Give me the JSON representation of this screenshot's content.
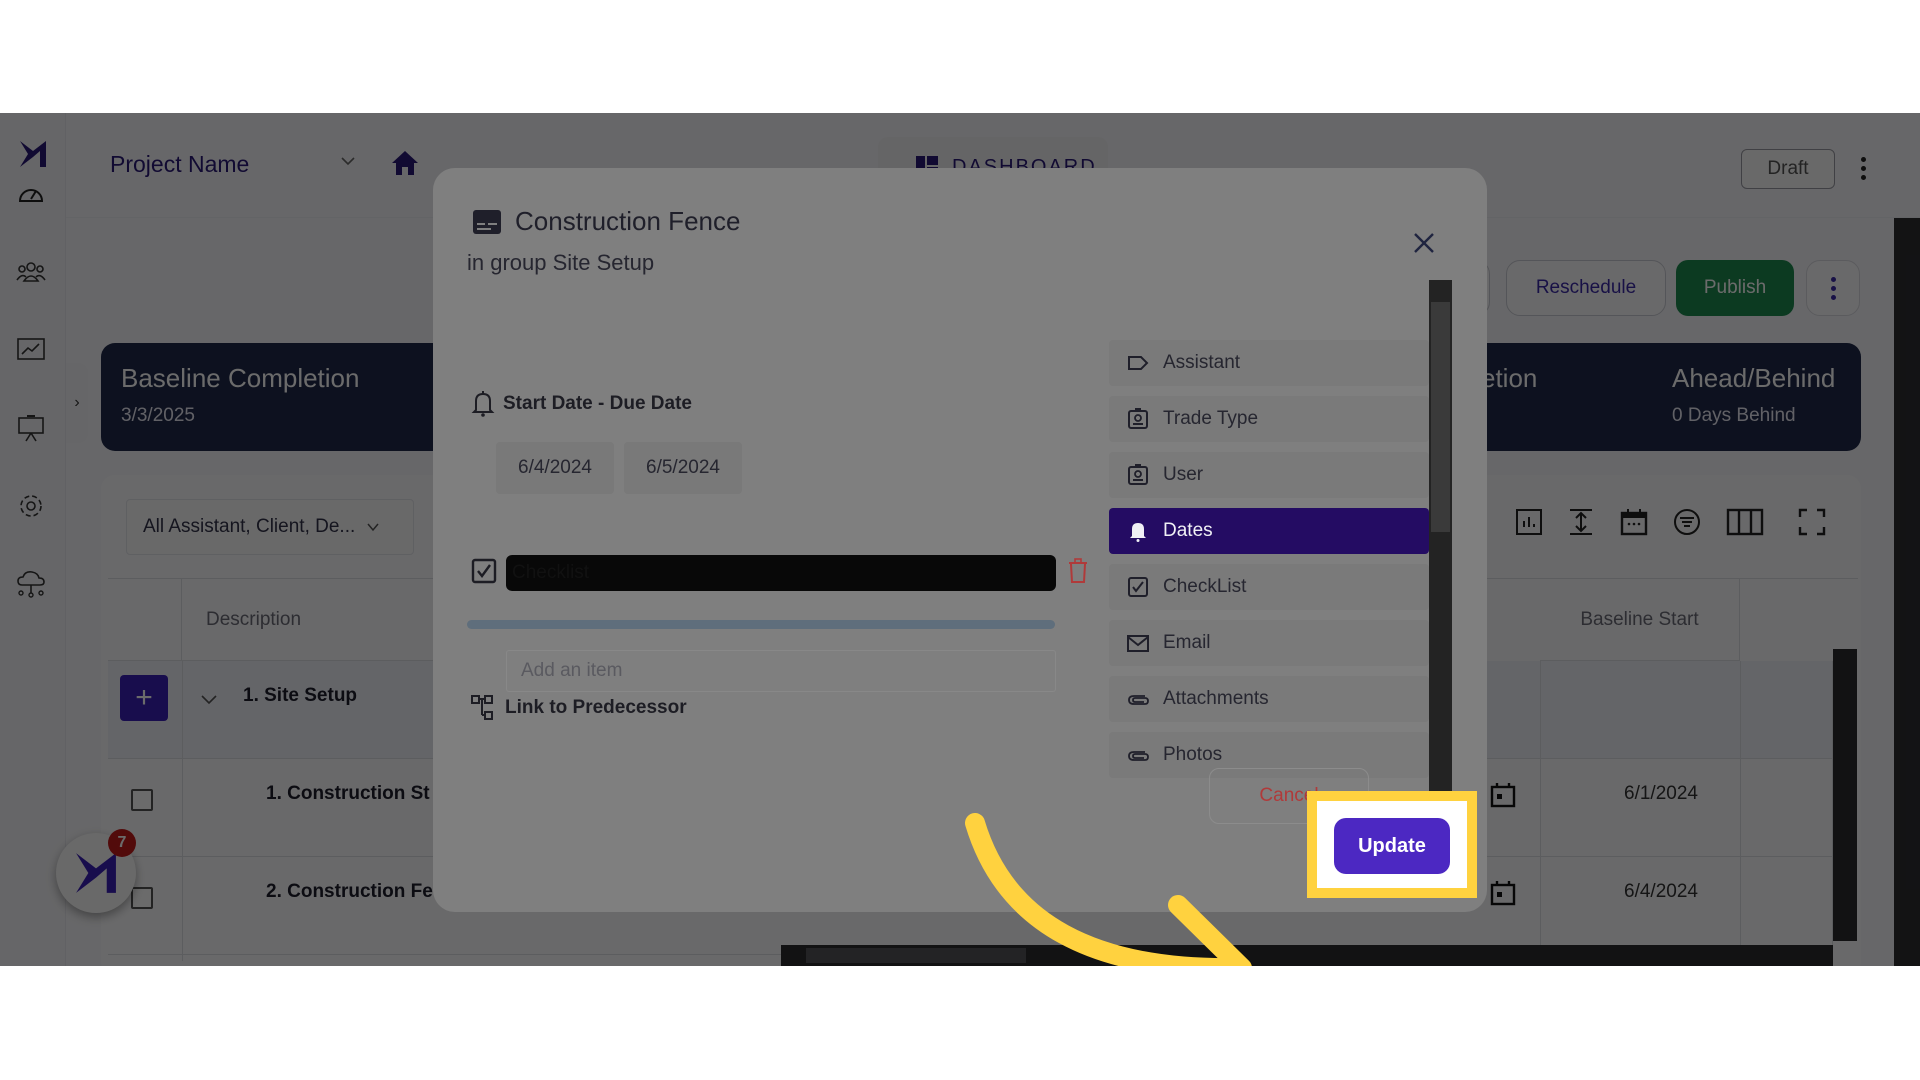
{
  "header": {
    "project_name": "Project Name",
    "dashboard_tab": "DASHBOARD",
    "status_button": "Draft"
  },
  "sidebar": {
    "items": [
      {
        "icon": "speedometer-icon"
      },
      {
        "icon": "users-icon"
      },
      {
        "icon": "chart-line-icon"
      },
      {
        "icon": "presentation-icon"
      },
      {
        "icon": "gear-icon"
      },
      {
        "icon": "cloud-network-icon"
      }
    ]
  },
  "actions": {
    "reschedule": "Reschedule",
    "publish": "Publish"
  },
  "banner": {
    "baseline_completion_label": "Baseline Completion",
    "baseline_completion_value": "3/3/2025",
    "projected_completion_label_partial": "etion",
    "ahead_behind_label": "Ahead/Behind",
    "ahead_behind_value": "0 Days Behind"
  },
  "table": {
    "filter_value": "All Assistant, Client, De...",
    "columns": [
      "Description",
      "Baseline Start"
    ],
    "group_row": "1. Site Setup",
    "rows": [
      {
        "description": "1. Construction St",
        "baseline_start": "6/1/2024"
      },
      {
        "description": "2. Construction Fe",
        "baseline_start": "6/4/2024"
      }
    ]
  },
  "chat": {
    "badge_count": "7"
  },
  "modal": {
    "title": "Construction Fence",
    "subtitle": "in group Site Setup",
    "dates_section_label": "Start Date - Due Date",
    "start_date": "6/4/2024",
    "due_date": "6/5/2024",
    "checklist_item_value": "Checklist",
    "checklist_progress_percent": 100,
    "add_item_placeholder": "Add an item",
    "predecessor_label": "Link to Predecessor",
    "side_menu": [
      {
        "label": "Assistant",
        "icon": "tag-icon",
        "active": false
      },
      {
        "label": "Trade Type",
        "icon": "badge-icon",
        "active": false
      },
      {
        "label": "User",
        "icon": "badge-icon",
        "active": false
      },
      {
        "label": "Dates",
        "icon": "bell-icon",
        "active": true
      },
      {
        "label": "CheckList",
        "icon": "checkbox-icon",
        "active": false
      },
      {
        "label": "Email",
        "icon": "mail-icon",
        "active": false
      },
      {
        "label": "Attachments",
        "icon": "paperclip-icon",
        "active": false
      },
      {
        "label": "Photos",
        "icon": "paperclip-icon",
        "active": false
      }
    ],
    "cancel_label": "Cancel",
    "update_label": "Update"
  },
  "colors": {
    "brand_purple": "#2a1a78",
    "active_menu": "#240c63",
    "update_button": "#4c28c2",
    "publish_green": "#1d8a50",
    "highlight_yellow": "#ffd23f",
    "cancel_red": "#b03a3a"
  }
}
